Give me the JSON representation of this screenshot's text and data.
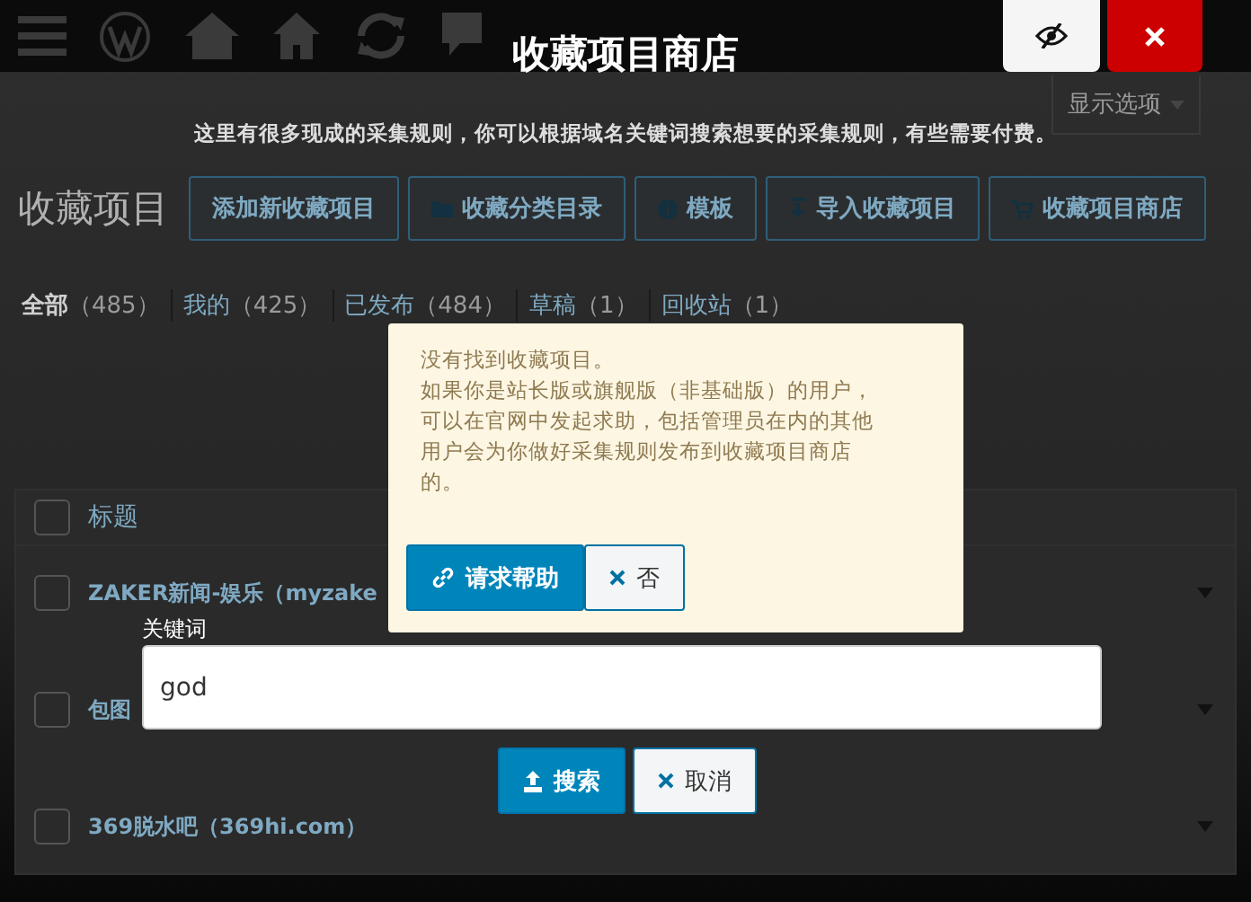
{
  "screen_options": {
    "label": "显示选项"
  },
  "page": {
    "title": "收藏项目",
    "actions": [
      {
        "label": "添加新收藏项目",
        "kind": "plain"
      },
      {
        "label": "收藏分类目录",
        "kind": "folder"
      },
      {
        "label": "模板",
        "kind": "info"
      },
      {
        "label": "导入收藏项目",
        "kind": "import"
      },
      {
        "label": "收藏项目商店",
        "kind": "cart"
      }
    ]
  },
  "filters": [
    {
      "label": "全部",
      "count": "（485）",
      "selected": true
    },
    {
      "label": "我的",
      "count": "（425）",
      "selected": false
    },
    {
      "label": "已发布",
      "count": "（484）",
      "selected": false
    },
    {
      "label": "草稿",
      "count": "（1）",
      "selected": false
    },
    {
      "label": "回收站",
      "count": "（1）",
      "selected": false
    }
  ],
  "table": {
    "select_all_checked": false,
    "columns": [
      "标题"
    ],
    "rows": [
      {
        "title": "ZAKER新闻-娱乐（myzake",
        "checked": false
      },
      {
        "title": "包图",
        "checked": false
      },
      {
        "title": "369脱水吧（369hi.com）",
        "checked": false
      }
    ]
  },
  "dialog": {
    "title": "收藏项目商店",
    "subtitle": "这里有很多现成的采集规则，你可以根据域名关键词搜索想要的采集规则，有些需要付费。",
    "keyword_label": "关键词",
    "keyword_value": "god",
    "buttons": [
      {
        "label": "搜索",
        "kind": "primary"
      },
      {
        "label": "取消",
        "kind": "secondary"
      }
    ]
  },
  "notice": {
    "lines": [
      "没有找到收藏项目。",
      "如果你是站长版或旗舰版（非基础版）的用户，可以在官网中发起求助，包括管理员在内的其他用户会为你做好采集规则发布到收藏项目商店的。"
    ],
    "buttons": [
      {
        "label": "请求帮助",
        "kind": "primary"
      },
      {
        "label": "否",
        "kind": "secondary"
      }
    ]
  }
}
